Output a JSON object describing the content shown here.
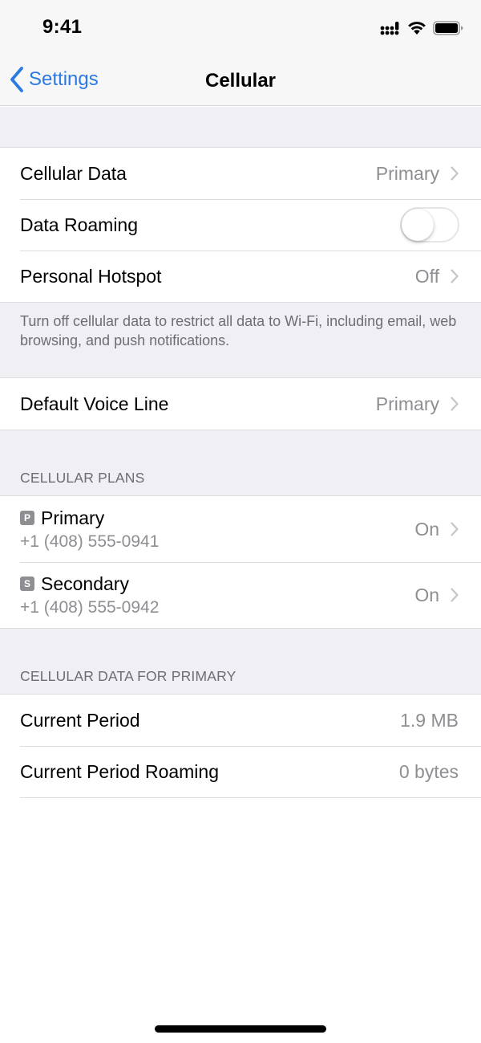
{
  "status_bar": {
    "time": "9:41",
    "icons": [
      "cellular-signal-icon",
      "wifi-icon",
      "battery-icon"
    ]
  },
  "nav": {
    "back_label": "Settings",
    "title": "Cellular"
  },
  "group1": {
    "rows": [
      {
        "label": "Cellular Data",
        "value": "Primary"
      },
      {
        "label": "Data Roaming",
        "toggle": false
      },
      {
        "label": "Personal Hotspot",
        "value": "Off"
      }
    ],
    "footer": "Turn off cellular data to restrict all data to Wi-Fi, including email, web browsing, and push notifications."
  },
  "group2": {
    "rows": [
      {
        "label": "Default Voice Line",
        "value": "Primary"
      }
    ]
  },
  "plans": {
    "header": "CELLULAR PLANS",
    "items": [
      {
        "badge": "P",
        "name": "Primary",
        "number": "+1 (408) 555-0941",
        "value": "On"
      },
      {
        "badge": "S",
        "name": "Secondary",
        "number": "+1 (408) 555-0942",
        "value": "On"
      }
    ]
  },
  "usage": {
    "header": "CELLULAR DATA FOR PRIMARY",
    "rows": [
      {
        "label": "Current Period",
        "value": "1.9 MB"
      },
      {
        "label": "Current Period Roaming",
        "value": "0 bytes"
      }
    ]
  },
  "colors": {
    "accent": "#2a7ae2",
    "secondary_text": "#8e8e93",
    "grouped_background": "#efeff4"
  }
}
